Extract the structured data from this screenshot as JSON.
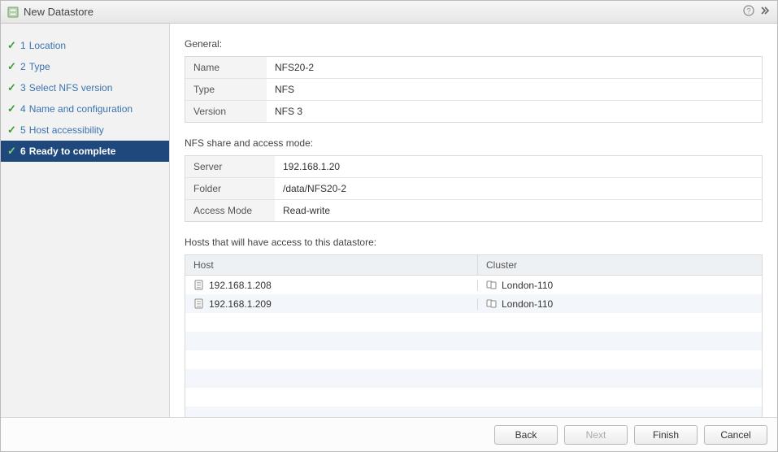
{
  "window": {
    "title": "New Datastore"
  },
  "steps": [
    {
      "num": "1",
      "label": "Location",
      "done": true,
      "active": false
    },
    {
      "num": "2",
      "label": "Type",
      "done": true,
      "active": false
    },
    {
      "num": "3",
      "label": "Select NFS version",
      "done": true,
      "active": false
    },
    {
      "num": "4",
      "label": "Name and configuration",
      "done": true,
      "active": false
    },
    {
      "num": "5",
      "label": "Host accessibility",
      "done": true,
      "active": false
    },
    {
      "num": "6",
      "label": "Ready to complete",
      "done": true,
      "active": true
    }
  ],
  "general": {
    "heading": "General:",
    "name_label": "Name",
    "name_value": "NFS20-2",
    "type_label": "Type",
    "type_value": "NFS",
    "version_label": "Version",
    "version_value": "NFS 3"
  },
  "nfs": {
    "heading": "NFS share and access mode:",
    "server_label": "Server",
    "server_value": "192.168.1.20",
    "folder_label": "Folder",
    "folder_value": "/data/NFS20-2",
    "access_label": "Access Mode",
    "access_value": "Read-write"
  },
  "hosts": {
    "heading": "Hosts that will have access to this datastore:",
    "columns": {
      "host": "Host",
      "cluster": "Cluster"
    },
    "rows": [
      {
        "host": "192.168.1.208",
        "cluster": "London-110"
      },
      {
        "host": "192.168.1.209",
        "cluster": "London-110"
      }
    ]
  },
  "buttons": {
    "back": "Back",
    "next": "Next",
    "finish": "Finish",
    "cancel": "Cancel"
  }
}
